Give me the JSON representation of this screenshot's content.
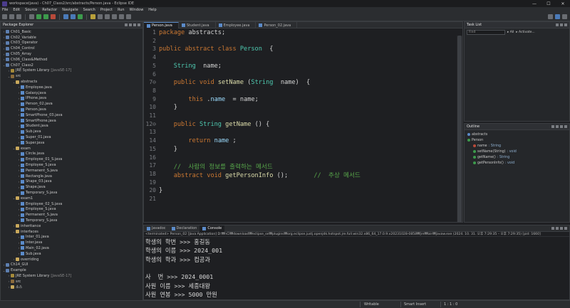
{
  "window": {
    "title": "workspace(java) - Ch07_Class2/src/abstracts/Person.java - Eclipse IDE",
    "controls": [
      "—",
      "☐",
      "✕"
    ]
  },
  "menu": [
    "File",
    "Edit",
    "Source",
    "Refactor",
    "Navigate",
    "Search",
    "Project",
    "Run",
    "Window",
    "Help"
  ],
  "package_explorer": {
    "title": "Package Explorer",
    "items": [
      {
        "label": "Ch01_Basic",
        "type": "proj",
        "indent": 0,
        "arrow": "›"
      },
      {
        "label": "Ch02_Variable",
        "type": "proj",
        "indent": 0,
        "arrow": "›"
      },
      {
        "label": "Ch03_Operator",
        "type": "proj",
        "indent": 0,
        "arrow": "›"
      },
      {
        "label": "Ch04_Control",
        "type": "proj",
        "indent": 0,
        "arrow": "›"
      },
      {
        "label": "Ch05_Array",
        "type": "proj",
        "indent": 0,
        "arrow": "›"
      },
      {
        "label": "Ch06_Class&Method",
        "type": "proj",
        "indent": 0,
        "arrow": "›"
      },
      {
        "label": "Ch07_Class2",
        "type": "proj",
        "indent": 0,
        "arrow": "⌄"
      },
      {
        "label": "JRE System Library",
        "suffix": "[JavaSE-17]",
        "type": "lib",
        "indent": 1,
        "arrow": "›"
      },
      {
        "label": "src",
        "type": "src",
        "indent": 1,
        "arrow": "⌄"
      },
      {
        "label": "abstracts",
        "type": "pkg",
        "indent": 2,
        "arrow": "⌄"
      },
      {
        "label": "Employee.java",
        "type": "java",
        "indent": 3,
        "arrow": "›"
      },
      {
        "label": "Galaxy.java",
        "type": "java",
        "indent": 3,
        "arrow": "›"
      },
      {
        "label": "IPhone.java",
        "type": "java",
        "indent": 3,
        "arrow": "›"
      },
      {
        "label": "Person_02.java",
        "type": "java",
        "indent": 3,
        "arrow": "›"
      },
      {
        "label": "Person.java",
        "type": "java",
        "indent": 3,
        "arrow": "›"
      },
      {
        "label": "SmartPhone_03.java",
        "type": "java",
        "indent": 3,
        "arrow": "›"
      },
      {
        "label": "SmartPhone.java",
        "type": "java",
        "indent": 3,
        "arrow": "›"
      },
      {
        "label": "Student.java",
        "type": "java",
        "indent": 3,
        "arrow": "›"
      },
      {
        "label": "Sub.java",
        "type": "java",
        "indent": 3,
        "arrow": "›"
      },
      {
        "label": "Super_01.java",
        "type": "java",
        "indent": 3,
        "arrow": "›"
      },
      {
        "label": "Super.java",
        "type": "java",
        "indent": 3,
        "arrow": "›"
      },
      {
        "label": "exam",
        "type": "pkg",
        "indent": 2,
        "arrow": "⌄"
      },
      {
        "label": "Circle.java",
        "type": "java",
        "indent": 3,
        "arrow": "›"
      },
      {
        "label": "Employee_01_S.java",
        "type": "java",
        "indent": 3,
        "arrow": "›"
      },
      {
        "label": "Employee_S.java",
        "type": "java",
        "indent": 3,
        "arrow": "›"
      },
      {
        "label": "Permanent_S.java",
        "type": "java",
        "indent": 3,
        "arrow": "›"
      },
      {
        "label": "Rectangle.java",
        "type": "java",
        "indent": 3,
        "arrow": "›"
      },
      {
        "label": "Shape_03.java",
        "type": "java",
        "indent": 3,
        "arrow": "›"
      },
      {
        "label": "Shape.java",
        "type": "java",
        "indent": 3,
        "arrow": "›"
      },
      {
        "label": "Temporary_S.java",
        "type": "java",
        "indent": 3,
        "arrow": "›"
      },
      {
        "label": "exam1",
        "type": "pkg",
        "indent": 2,
        "arrow": "⌄"
      },
      {
        "label": "Employee_02_S.java",
        "type": "java",
        "indent": 3,
        "arrow": "›"
      },
      {
        "label": "Employee_S.java",
        "type": "java",
        "indent": 3,
        "arrow": "›"
      },
      {
        "label": "Permanent_S.java",
        "type": "java",
        "indent": 3,
        "arrow": "›"
      },
      {
        "label": "Temporary_S.java",
        "type": "java",
        "indent": 3,
        "arrow": "›"
      },
      {
        "label": "inheritance",
        "type": "pkg",
        "indent": 2,
        "arrow": "›"
      },
      {
        "label": "interfaces",
        "type": "pkg",
        "indent": 2,
        "arrow": "⌄"
      },
      {
        "label": "Inter_01.java",
        "type": "java",
        "indent": 3,
        "arrow": "›"
      },
      {
        "label": "Inter.java",
        "type": "java",
        "indent": 3,
        "arrow": "›"
      },
      {
        "label": "Main_02.java",
        "type": "java",
        "indent": 3,
        "arrow": "›"
      },
      {
        "label": "Sub.java",
        "type": "java",
        "indent": 3,
        "arrow": "›"
      },
      {
        "label": "overriding",
        "type": "pkg",
        "indent": 2,
        "arrow": "›"
      },
      {
        "label": "Ch14_GUI",
        "type": "proj",
        "indent": 0,
        "arrow": "›"
      },
      {
        "label": "Example",
        "type": "proj",
        "indent": 0,
        "arrow": "⌄"
      },
      {
        "label": "JRE System Library",
        "suffix": "[JavaSE-17]",
        "type": "lib",
        "indent": 1,
        "arrow": "›"
      },
      {
        "label": "src",
        "type": "src",
        "indent": 1,
        "arrow": "›"
      },
      {
        "label": "소스",
        "type": "folder",
        "indent": 1,
        "arrow": "›"
      }
    ]
  },
  "editor": {
    "tabs": [
      {
        "label": "Person.java",
        "active": true
      },
      {
        "label": "Student.java",
        "active": false
      },
      {
        "label": "Employee.java",
        "active": false
      },
      {
        "label": "Person_02.java",
        "active": false
      }
    ],
    "lines": [
      {
        "n": "1",
        "tokens": [
          [
            "kw",
            "package"
          ],
          [
            "",
            "abstracts;"
          ]
        ]
      },
      {
        "n": "2",
        "tokens": []
      },
      {
        "n": "3",
        "tokens": [
          [
            "kw",
            "public abstract class"
          ],
          [
            "",
            ""
          ],
          [
            "ty",
            "Person"
          ],
          [
            "",
            " {"
          ]
        ]
      },
      {
        "n": "4",
        "tokens": []
      },
      {
        "n": "5",
        "tokens": [
          [
            "",
            "    "
          ],
          [
            "ty",
            "String"
          ],
          [
            "",
            " name;"
          ]
        ]
      },
      {
        "n": "6",
        "tokens": []
      },
      {
        "n": "7⊖",
        "tokens": [
          [
            "",
            "    "
          ],
          [
            "kw",
            "public void"
          ],
          [
            "",
            ""
          ],
          [
            "fn",
            "setName"
          ],
          [
            "",
            "("
          ],
          [
            "ty",
            "String"
          ],
          [
            "",
            " name)  {"
          ]
        ]
      },
      {
        "n": "8",
        "tokens": []
      },
      {
        "n": "9",
        "tokens": [
          [
            "",
            "        "
          ],
          [
            "kw",
            "this"
          ],
          [
            "",
            "."
          ],
          [
            "fld",
            "name"
          ],
          [
            "",
            " = name;"
          ]
        ]
      },
      {
        "n": "10",
        "tokens": [
          [
            "",
            "    }"
          ]
        ]
      },
      {
        "n": "11",
        "tokens": []
      },
      {
        "n": "12⊖",
        "tokens": [
          [
            "",
            "    "
          ],
          [
            "kw",
            "public"
          ],
          [
            "",
            ""
          ],
          [
            "ty",
            "String"
          ],
          [
            "",
            ""
          ],
          [
            "fn",
            "getName"
          ],
          [
            "",
            "() {"
          ]
        ]
      },
      {
        "n": "13",
        "tokens": []
      },
      {
        "n": "14",
        "tokens": [
          [
            "",
            "        "
          ],
          [
            "kw",
            "return"
          ],
          [
            "",
            ""
          ],
          [
            "fld",
            "name"
          ],
          [
            "",
            ";"
          ]
        ]
      },
      {
        "n": "15",
        "tokens": [
          [
            "",
            "    }"
          ]
        ]
      },
      {
        "n": "16",
        "tokens": []
      },
      {
        "n": "17",
        "tokens": [
          [
            "",
            "    "
          ],
          [
            "cm",
            "//  사람의 정보를 출력하는 메서드"
          ]
        ]
      },
      {
        "n": "18",
        "tokens": [
          [
            "",
            "    "
          ],
          [
            "kw",
            "abstract void"
          ],
          [
            "",
            ""
          ],
          [
            "fn",
            "getPersonInfo"
          ],
          [
            "",
            "();       "
          ],
          [
            "cm",
            "//  추상 메서드"
          ]
        ]
      },
      {
        "n": "19",
        "tokens": []
      },
      {
        "n": "20",
        "tokens": [
          [
            "",
            "}"
          ]
        ]
      },
      {
        "n": "21",
        "tokens": []
      }
    ]
  },
  "task_list": {
    "title": "Task List",
    "find_placeholder": "Find",
    "all_label": "All",
    "activate_label": "Activate..."
  },
  "outline": {
    "title": "Outline",
    "items": [
      {
        "label": "abstracts",
        "kind": "pkg",
        "indent": 0,
        "type": ""
      },
      {
        "label": "Person",
        "kind": "class",
        "indent": 0,
        "type": ""
      },
      {
        "label": "name",
        "kind": "field",
        "indent": 1,
        "type": ": String"
      },
      {
        "label": "setName(String)",
        "kind": "method",
        "indent": 1,
        "type": ": void"
      },
      {
        "label": "getName()",
        "kind": "method",
        "indent": 1,
        "type": ": String"
      },
      {
        "label": "getPersonInfo()",
        "kind": "method",
        "indent": 1,
        "type": ": void"
      }
    ]
  },
  "console": {
    "tabs": [
      {
        "label": "Javadoc",
        "active": false
      },
      {
        "label": "Declaration",
        "active": false
      },
      {
        "label": "Console",
        "active": true
      }
    ],
    "info": "<terminated> Person_02 [Java Application] D:₩hCI₩download₩eclipse_se₩plugins₩org.eclipse.justj.openjdk.hotspot.jre.full.win32.x86_64_17.0.9.v20231028-0858₩jre₩bin₩javaw.exe  (2024. 10. 31. 오후 7:29:35 – 오후 7:29:35) [pid: 1660]",
    "lines": [
      "학생의 학번 >>> 홍길동",
      "학생의 이름 >>> 2024_001",
      "학생의 학과 >>> 컴공과",
      "",
      "사  번 >>> 2024_0001",
      "사원 이름 >>> 세종대왕",
      "사원 연봉 >>> 5000 만원"
    ]
  },
  "status": {
    "writable": "Writable",
    "insert": "Smart Insert",
    "position": "1 : 1 : 0"
  }
}
